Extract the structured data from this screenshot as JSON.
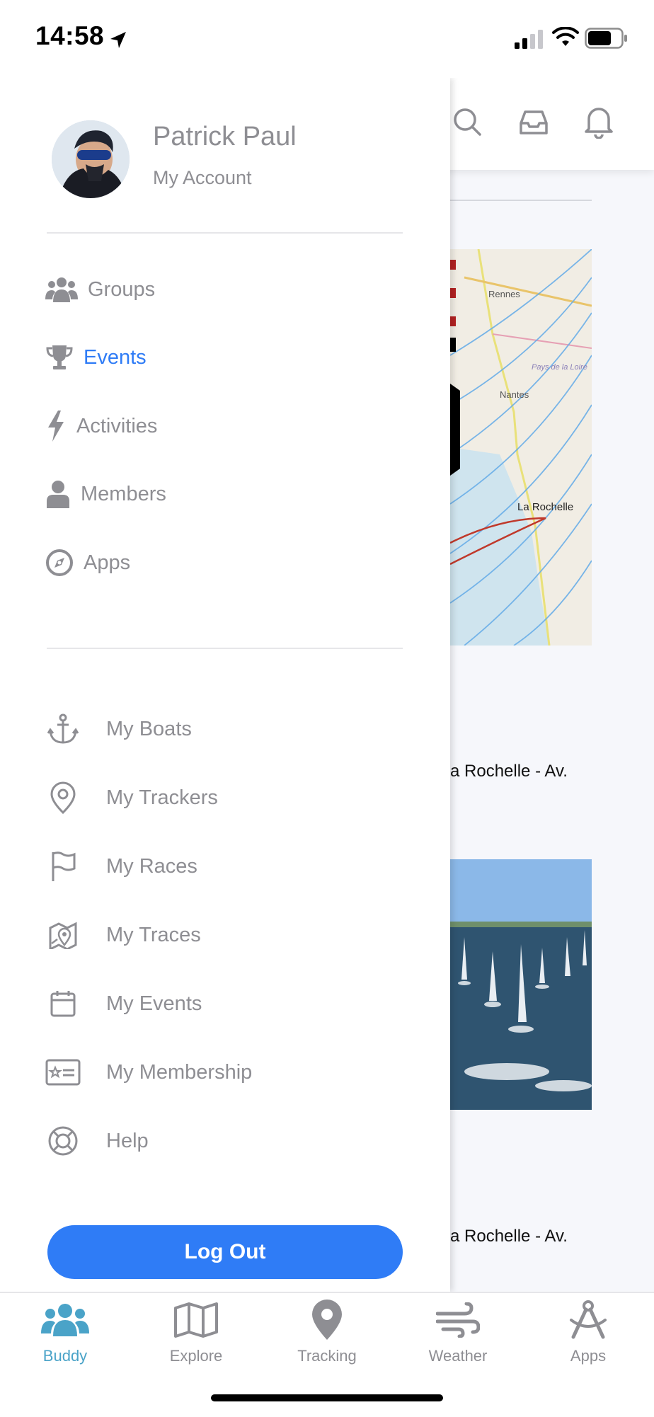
{
  "status_bar": {
    "time": "14:58",
    "icons": [
      "location-arrow-icon",
      "signal-icon",
      "wifi-icon",
      "battery-icon"
    ]
  },
  "header_icons": [
    "search-icon",
    "inbox-icon",
    "bell-icon"
  ],
  "user": {
    "name": "Patrick Paul",
    "subtitle": "My Account"
  },
  "menu": [
    {
      "label": "Groups",
      "icon": "groups-icon",
      "active": false
    },
    {
      "label": "Events",
      "icon": "trophy-icon",
      "active": true
    },
    {
      "label": "Activities",
      "icon": "bolt-icon",
      "active": false
    },
    {
      "label": "Members",
      "icon": "person-icon",
      "active": false
    },
    {
      "label": "Apps",
      "icon": "compass-icon",
      "active": false
    }
  ],
  "submenu": [
    {
      "label": "My Boats",
      "icon": "anchor-icon"
    },
    {
      "label": "My Trackers",
      "icon": "location-pin-icon"
    },
    {
      "label": "My Races",
      "icon": "flag-icon"
    },
    {
      "label": "My Traces",
      "icon": "map-trace-icon"
    },
    {
      "label": "My Events",
      "icon": "calendar-icon"
    },
    {
      "label": "My Membership",
      "icon": "member-card-icon"
    },
    {
      "label": "Help",
      "icon": "lifebuoy-icon"
    }
  ],
  "logout_label": "Log Out",
  "background": {
    "map_labels": [
      "Rennes",
      "Pays de la Loire",
      "Nantes",
      "La Rochelle"
    ],
    "event_text_1": "a Rochelle - Av.",
    "event_text_2": "a Rochelle - Av."
  },
  "tabs": [
    {
      "label": "Buddy",
      "icon": "buddy-icon",
      "active": true
    },
    {
      "label": "Explore",
      "icon": "map-icon",
      "active": false
    },
    {
      "label": "Tracking",
      "icon": "tracking-pin-icon",
      "active": false
    },
    {
      "label": "Weather",
      "icon": "wind-icon",
      "active": false
    },
    {
      "label": "Apps",
      "icon": "apps-compass-icon",
      "active": false
    }
  ],
  "colors": {
    "accent": "#2f7cf6",
    "tab_active": "#4aa3c8",
    "muted": "#8e8e93"
  }
}
